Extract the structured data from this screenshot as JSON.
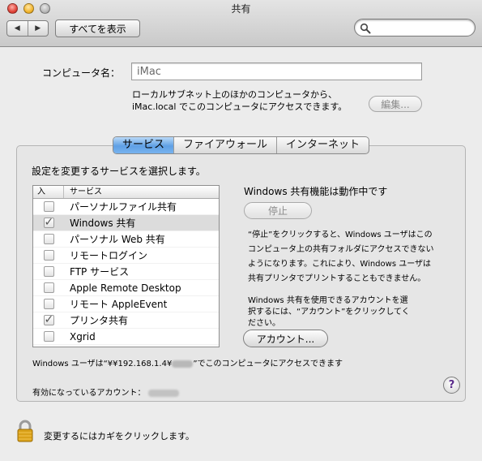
{
  "window": {
    "title": "共有"
  },
  "toolbar": {
    "back_label": "◀",
    "forward_label": "▶",
    "show_all_label": "すべてを表示",
    "search_value": ""
  },
  "computer_name": {
    "label": "コンピュータ名：",
    "value": "iMac",
    "description_line1": "ローカルサブネット上のほかのコンピュータから、",
    "description_line2": "iMac.local でこのコンピュータにアクセスできます。",
    "edit_button": "編集..."
  },
  "tabs": [
    {
      "label": "サービス",
      "active": true
    },
    {
      "label": "ファイアウォール",
      "active": false
    },
    {
      "label": "インターネット",
      "active": false
    }
  ],
  "services_prompt": "設定を変更するサービスを選択します。",
  "table": {
    "col_on": "入",
    "col_service": "サービス",
    "rows": [
      {
        "name": "パーソナルファイル共有",
        "checked": false,
        "selected": false
      },
      {
        "name": "Windows 共有",
        "checked": true,
        "selected": true
      },
      {
        "name": "パーソナル Web 共有",
        "checked": false,
        "selected": false
      },
      {
        "name": "リモートログイン",
        "checked": false,
        "selected": false
      },
      {
        "name": "FTP サービス",
        "checked": false,
        "selected": false
      },
      {
        "name": "Apple Remote Desktop",
        "checked": false,
        "selected": false
      },
      {
        "name": "リモート AppleEvent",
        "checked": false,
        "selected": false
      },
      {
        "name": "プリンタ共有",
        "checked": true,
        "selected": false
      },
      {
        "name": "Xgrid",
        "checked": false,
        "selected": false
      }
    ]
  },
  "status": {
    "title": "Windows 共有機能は動作中です",
    "stop_button": "停止",
    "para1": [
      "“停止”をクリックすると、Windows ユーザはこの",
      "コンピュータ上の共有フォルダにアクセスできない",
      "ようになります。これにより、Windows ユーザは",
      "共有プリンタでプリントすることもできません。"
    ],
    "para2": [
      "Windows 共有を使用できるアカウントを選",
      "択するには、“アカウント”をクリックしてく",
      "ださい。"
    ],
    "account_button": "アカウント..."
  },
  "address_line": {
    "prefix": "Windows ユーザは“¥¥192.168.1.4¥",
    "suffix": "”でこのコンピュータにアクセスできます"
  },
  "enabled_accounts_label": "有効になっているアカウント：",
  "help_label": "?",
  "lock_text": "変更するにはカギをクリックします。",
  "colors": {
    "accent_tab": "#5fa0e5",
    "window_bg": "#ececec"
  }
}
